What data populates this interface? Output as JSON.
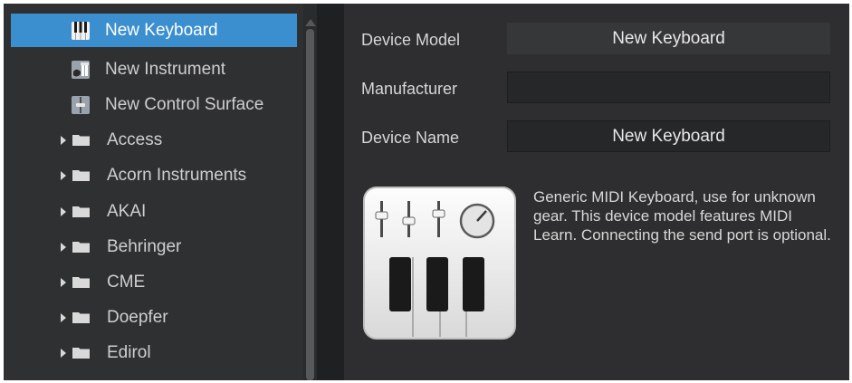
{
  "tree": {
    "items": [
      {
        "label": "New Keyboard",
        "kind": "device",
        "icon": "keyboard-icon",
        "selected": true
      },
      {
        "label": "New Instrument",
        "kind": "device",
        "icon": "instrument-icon",
        "selected": false
      },
      {
        "label": "New Control Surface",
        "kind": "device",
        "icon": "control-surface-icon",
        "selected": false
      },
      {
        "label": "Access",
        "kind": "folder",
        "icon": "folder-icon",
        "selected": false
      },
      {
        "label": "Acorn Instruments",
        "kind": "folder",
        "icon": "folder-icon",
        "selected": false
      },
      {
        "label": "AKAI",
        "kind": "folder",
        "icon": "folder-icon",
        "selected": false
      },
      {
        "label": "Behringer",
        "kind": "folder",
        "icon": "folder-icon",
        "selected": false
      },
      {
        "label": "CME",
        "kind": "folder",
        "icon": "folder-icon",
        "selected": false
      },
      {
        "label": "Doepfer",
        "kind": "folder",
        "icon": "folder-icon",
        "selected": false
      },
      {
        "label": "Edirol",
        "kind": "folder",
        "icon": "folder-icon",
        "selected": false
      }
    ]
  },
  "details": {
    "device_model_label": "Device Model",
    "device_model_value": "New Keyboard",
    "manufacturer_label": "Manufacturer",
    "manufacturer_value": "",
    "device_name_label": "Device Name",
    "device_name_value": "New Keyboard",
    "description": "Generic MIDI Keyboard, use for unknown gear. This device model features MIDI Learn. Connecting the send port is optional.",
    "icon": "midi-keyboard-icon"
  },
  "colors": {
    "selection": "#3b8fcf",
    "panel_background": "#2e2e30",
    "text": "#d8d8d8"
  }
}
